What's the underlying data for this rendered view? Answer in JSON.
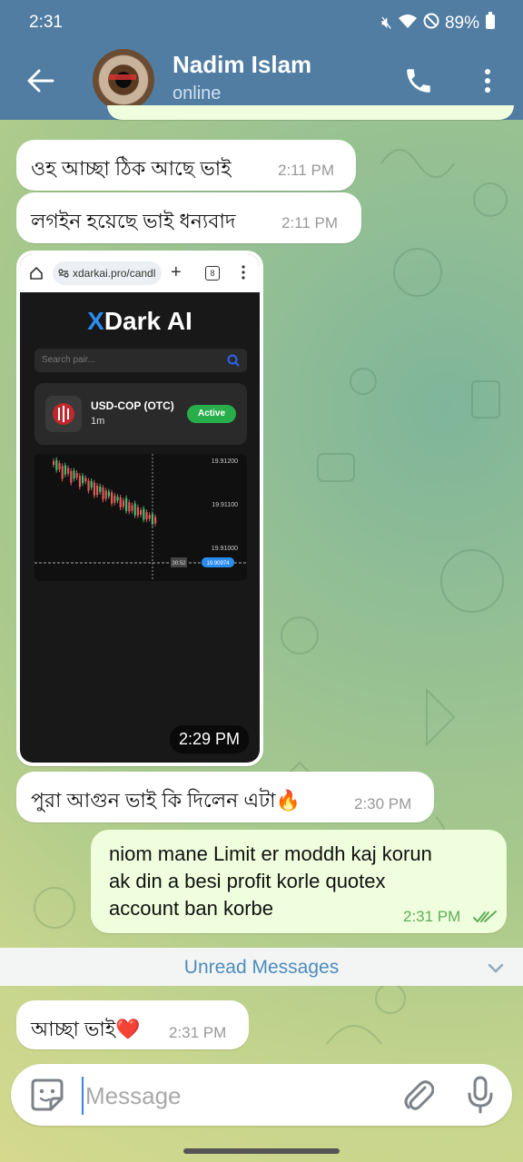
{
  "status_bar": {
    "time": "2:31",
    "battery": "89%"
  },
  "header": {
    "title": "Nadim Islam",
    "subtitle": "online"
  },
  "messages": [
    {
      "text": "ওহ আচ্ছা ঠিক আছে ভাই",
      "time": "2:11 PM"
    },
    {
      "text": "লগইন হয়েছে ভাই ধন্যবাদ",
      "time": "2:11 PM"
    },
    {
      "text": "পুরা আগুন ভাই কি দিলেন এটা🔥",
      "time": "2:30 PM"
    },
    {
      "lines": [
        "niom mane Limit er moddh kaj korun",
        "ak din a besi profit korle quotex",
        "account ban korbe"
      ],
      "time": "2:31 PM"
    },
    {
      "text": "আচ্ছা ভাই❤️",
      "time": "2:31 PM"
    }
  ],
  "image_message": {
    "time": "2:29 PM",
    "screenshot": {
      "url": "xdarkai.pro/candl",
      "tab_count": "8",
      "brand_x": "X",
      "brand_rest": "Dark AI",
      "search_placeholder": "Search pair...",
      "pair_name": "USD-COP (OTC)",
      "timeframe": "1m",
      "status_badge": "Active",
      "chart_prices": [
        "19.91200",
        "19.91100",
        "19.91000"
      ],
      "countdown": "30:52",
      "current_price": "19.90974"
    }
  },
  "unread_label": "Unread Messages",
  "composer": {
    "placeholder": "Message"
  },
  "colors": {
    "header": "#517da2",
    "outgoing_bubble": "#effedd",
    "accent": "#4f8bbd"
  }
}
